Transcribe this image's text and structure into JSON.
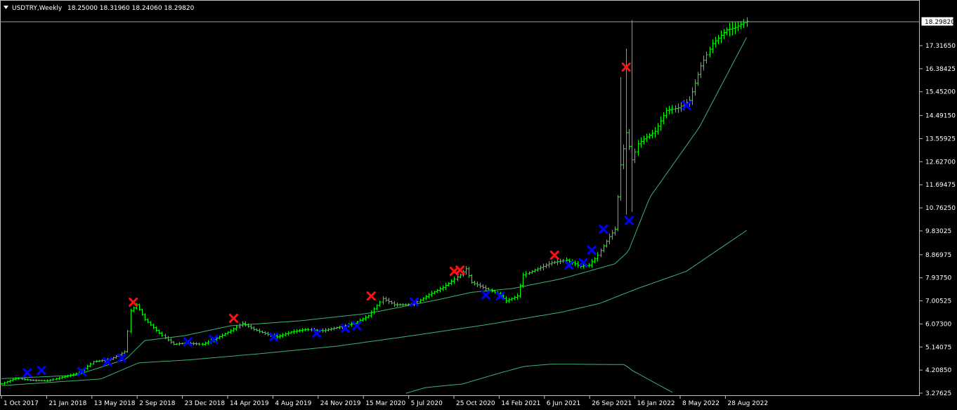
{
  "header": {
    "menu_icon": "triangle-down-icon",
    "symbol": "USDTRY,Weekly",
    "ohlc": "18.25000 18.31960 18.24060 18.29820"
  },
  "colors": {
    "background": "#000000",
    "bars": "#00ff00",
    "moving_averages": "#3cb371",
    "buy_marker": "#0000ff",
    "sell_marker": "#ff1010",
    "border": "#c0c0c0"
  },
  "chart_data": {
    "type": "ohlc-bar",
    "title": "USDTRY,Weekly",
    "ylim": [
      3.2,
      18.4
    ],
    "current_price": "18.29820",
    "y_ticks": [
      "17.31650",
      "16.38425",
      "15.45200",
      "14.49150",
      "13.55925",
      "12.62700",
      "11.69475",
      "10.76250",
      "9.83025",
      "8.86975",
      "7.93750",
      "7.00525",
      "6.07300",
      "5.14075",
      "4.20850",
      "3.27625"
    ],
    "y_tick_values": [
      17.3165,
      16.38425,
      15.452,
      14.4915,
      13.55925,
      12.627,
      11.69475,
      10.7625,
      9.83025,
      8.86975,
      7.9375,
      7.00525,
      6.073,
      5.14075,
      4.2085,
      3.27625
    ],
    "x_ticks": [
      "1 Oct 2017",
      "21 Jan 2018",
      "13 May 2018",
      "2 Sep 2018",
      "23 Dec 2018",
      "14 Apr 2019",
      "4 Aug 2019",
      "24 Nov 2019",
      "15 Mar 2020",
      "5 Jul 2020",
      "25 Oct 2020",
      "14 Feb 2021",
      "6 Jun 2021",
      "26 Sep 2021",
      "16 Jan 2022",
      "8 May 2022",
      "28 Aug 2022"
    ],
    "close_anchors": [
      [
        "2017-10-01",
        3.65
      ],
      [
        "2017-11-05",
        3.88
      ],
      [
        "2017-12-10",
        3.8
      ],
      [
        "2018-01-21",
        3.78
      ],
      [
        "2018-03-04",
        3.95
      ],
      [
        "2018-04-08",
        4.1
      ],
      [
        "2018-05-13",
        4.55
      ],
      [
        "2018-06-24",
        4.65
      ],
      [
        "2018-07-29",
        4.95
      ],
      [
        "2018-08-12",
        6.6
      ],
      [
        "2018-08-26",
        6.85
      ],
      [
        "2018-09-16",
        6.25
      ],
      [
        "2018-10-21",
        5.7
      ],
      [
        "2018-11-25",
        5.25
      ],
      [
        "2018-12-23",
        5.3
      ],
      [
        "2019-02-03",
        5.25
      ],
      [
        "2019-03-10",
        5.5
      ],
      [
        "2019-04-14",
        5.8
      ],
      [
        "2019-05-12",
        6.1
      ],
      [
        "2019-06-09",
        5.85
      ],
      [
        "2019-07-14",
        5.65
      ],
      [
        "2019-08-04",
        5.55
      ],
      [
        "2019-09-08",
        5.75
      ],
      [
        "2019-10-13",
        5.85
      ],
      [
        "2019-11-24",
        5.8
      ],
      [
        "2020-01-05",
        5.95
      ],
      [
        "2020-02-09",
        6.1
      ],
      [
        "2020-03-15",
        6.4
      ],
      [
        "2020-04-19",
        7.1
      ],
      [
        "2020-05-17",
        6.85
      ],
      [
        "2020-06-14",
        6.85
      ],
      [
        "2020-07-05",
        6.9
      ],
      [
        "2020-08-09",
        7.25
      ],
      [
        "2020-09-13",
        7.55
      ],
      [
        "2020-10-25",
        8.05
      ],
      [
        "2020-11-08",
        8.3
      ],
      [
        "2020-11-22",
        7.75
      ],
      [
        "2020-12-20",
        7.55
      ],
      [
        "2021-01-24",
        7.3
      ],
      [
        "2021-02-14",
        7.0
      ],
      [
        "2021-03-14",
        7.2
      ],
      [
        "2021-03-28",
        8.05
      ],
      [
        "2021-05-02",
        8.3
      ],
      [
        "2021-06-06",
        8.55
      ],
      [
        "2021-07-11",
        8.65
      ],
      [
        "2021-08-15",
        8.4
      ],
      [
        "2021-09-05",
        8.45
      ],
      [
        "2021-09-26",
        8.85
      ],
      [
        "2021-10-24",
        9.6
      ],
      [
        "2021-11-07",
        9.9
      ],
      [
        "2021-11-21",
        12.5
      ],
      [
        "2021-12-05",
        13.8
      ],
      [
        "2021-12-19",
        12.7
      ],
      [
        "2022-01-02",
        13.35
      ],
      [
        "2022-01-16",
        13.55
      ],
      [
        "2022-02-13",
        13.85
      ],
      [
        "2022-03-13",
        14.7
      ],
      [
        "2022-04-10",
        14.8
      ],
      [
        "2022-05-08",
        15.1
      ],
      [
        "2022-06-05",
        16.5
      ],
      [
        "2022-07-03",
        17.4
      ],
      [
        "2022-08-07",
        17.95
      ],
      [
        "2022-08-28",
        18.05
      ],
      [
        "2022-09-25",
        18.3
      ]
    ],
    "spikes": [
      [
        "2021-11-21",
        11.05,
        16.05
      ],
      [
        "2021-12-05",
        10.5,
        17.2
      ],
      [
        "2021-12-19",
        10.6,
        18.35
      ]
    ],
    "ma_slow_anchors": [
      [
        "2017-10-01",
        3.58
      ],
      [
        "2018-06-01",
        3.85
      ],
      [
        "2018-09-01",
        4.5
      ],
      [
        "2019-01-01",
        4.62
      ],
      [
        "2019-07-01",
        4.88
      ],
      [
        "2020-01-01",
        5.18
      ],
      [
        "2020-07-01",
        5.6
      ],
      [
        "2021-01-01",
        6.05
      ],
      [
        "2021-07-01",
        6.55
      ],
      [
        "2021-10-01",
        6.9
      ],
      [
        "2022-01-01",
        7.5
      ],
      [
        "2022-05-01",
        8.2
      ],
      [
        "2022-09-25",
        9.85
      ]
    ],
    "ma_mid_anchors": [
      [
        "2017-10-01",
        3.86
      ],
      [
        "2018-04-01",
        4.0
      ],
      [
        "2018-08-01",
        4.65
      ],
      [
        "2018-09-16",
        5.4
      ],
      [
        "2018-12-23",
        5.6
      ],
      [
        "2019-04-14",
        6.0
      ],
      [
        "2019-10-01",
        6.2
      ],
      [
        "2020-03-15",
        6.5
      ],
      [
        "2020-09-01",
        7.05
      ],
      [
        "2020-11-22",
        7.35
      ],
      [
        "2021-03-01",
        7.5
      ],
      [
        "2021-07-01",
        7.9
      ],
      [
        "2021-11-07",
        8.5
      ],
      [
        "2021-12-10",
        9.0
      ],
      [
        "2022-02-01",
        11.2
      ],
      [
        "2022-06-01",
        14.0
      ],
      [
        "2022-09-25",
        17.65
      ]
    ],
    "ma_band_anchors": [
      [
        "2020-06-15",
        3.27
      ],
      [
        "2020-08-01",
        3.5
      ],
      [
        "2020-11-01",
        3.65
      ],
      [
        "2021-02-01",
        4.1
      ],
      [
        "2021-04-01",
        4.36
      ],
      [
        "2021-06-06",
        4.45
      ],
      [
        "2021-12-01",
        4.43
      ],
      [
        "2021-12-19",
        4.2
      ],
      [
        "2022-02-01",
        3.8
      ],
      [
        "2022-04-01",
        3.27
      ]
    ],
    "buy_markers": [
      [
        "2017-12-03",
        4.1
      ],
      [
        "2018-01-07",
        4.2
      ],
      [
        "2018-04-15",
        4.15
      ],
      [
        "2018-06-17",
        4.55
      ],
      [
        "2018-07-22",
        4.7
      ],
      [
        "2018-12-30",
        5.35
      ],
      [
        "2019-03-03",
        5.45
      ],
      [
        "2019-07-28",
        5.55
      ],
      [
        "2019-11-10",
        5.7
      ],
      [
        "2020-01-19",
        5.9
      ],
      [
        "2020-02-16",
        6.0
      ],
      [
        "2020-07-05",
        6.95
      ],
      [
        "2020-12-27",
        7.25
      ],
      [
        "2021-01-31",
        7.2
      ],
      [
        "2021-07-18",
        8.45
      ],
      [
        "2021-08-22",
        8.55
      ],
      [
        "2021-09-12",
        9.05
      ],
      [
        "2021-10-10",
        9.9
      ],
      [
        "2021-12-12",
        10.25
      ],
      [
        "2022-05-01",
        14.9
      ]
    ],
    "sell_markers": [
      [
        "2018-08-19",
        6.95
      ],
      [
        "2019-04-21",
        6.3
      ],
      [
        "2020-03-22",
        7.2
      ],
      [
        "2020-10-11",
        8.2
      ],
      [
        "2020-10-25",
        8.25
      ],
      [
        "2021-06-13",
        8.85
      ],
      [
        "2021-12-05",
        16.45
      ]
    ]
  }
}
